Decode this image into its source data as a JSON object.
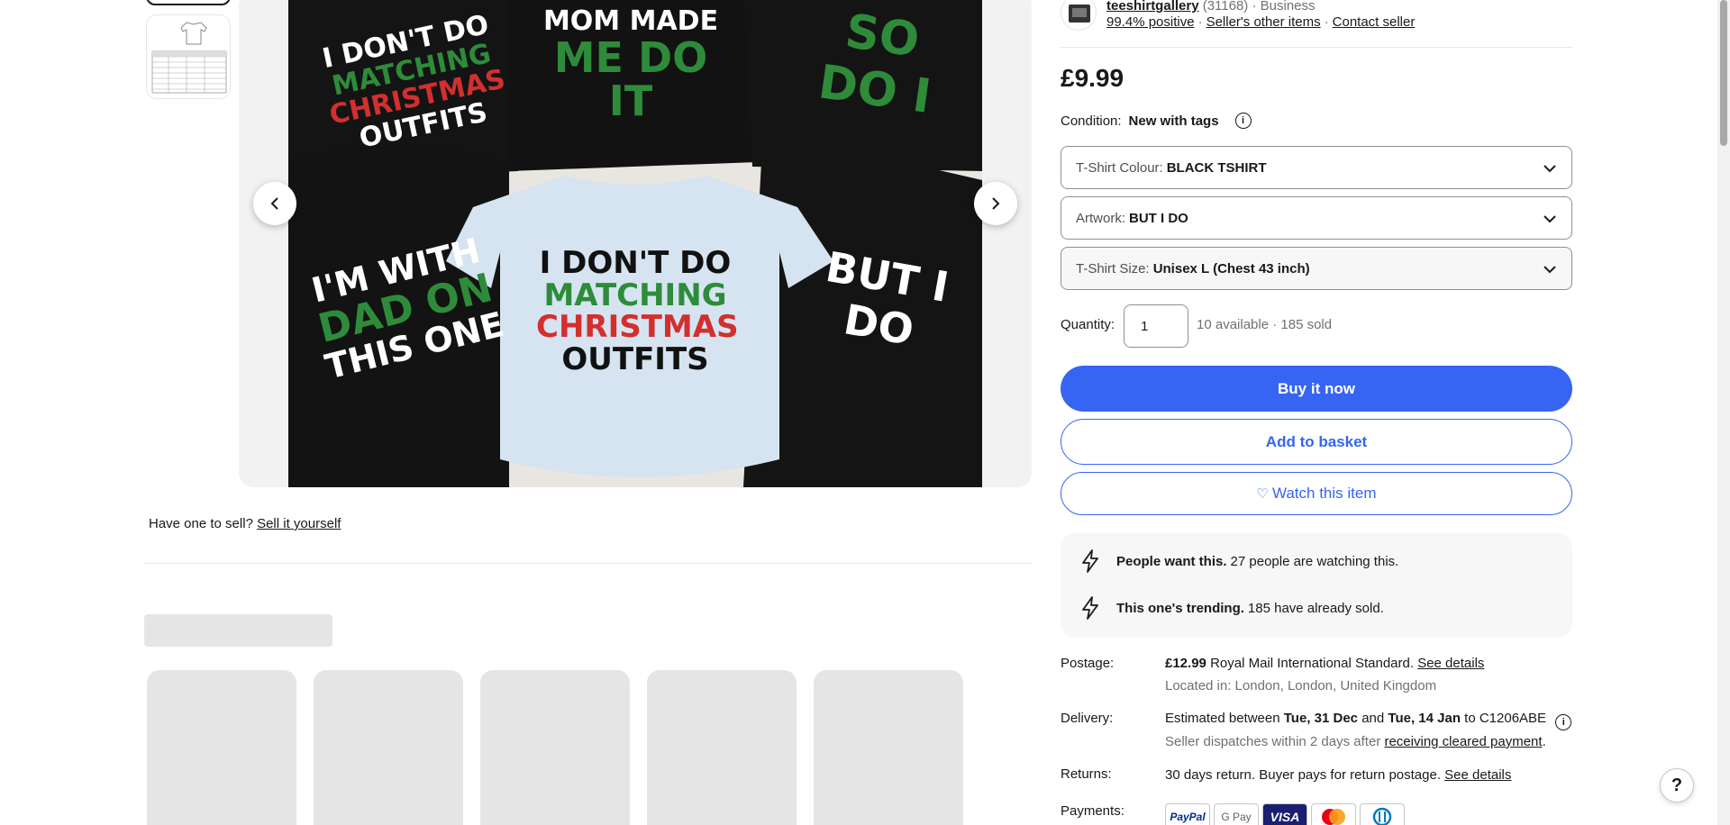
{
  "gallery": {
    "shirts": [
      {
        "line1": "I DON'T DO",
        "line2": "MATCHING",
        "line3": "CHRISTMAS",
        "line4": "OUTFITS"
      },
      {
        "line1": "MOM MADE",
        "line2": "ME DO IT"
      },
      {
        "line1": "SO DO I"
      },
      {
        "line1": "I'M WITH",
        "line2": "DAD ON",
        "line3": "THIS ONE"
      },
      {
        "line1": "I DON'T DO",
        "line2": "MATCHING",
        "line3": "CHRISTMAS",
        "line4": "OUTFITS"
      },
      {
        "line1": "BUT I DO"
      }
    ],
    "prev_icon": "chevron-left-icon",
    "next_icon": "chevron-right-icon"
  },
  "sell": {
    "prompt": "Have one to sell?",
    "link": "Sell it yourself"
  },
  "seller": {
    "name": "teeshirtgallery",
    "feedback_count": "(31168)",
    "type": "· Business",
    "positive": "99.4% positive",
    "other_items": "Seller's other items",
    "contact": "Contact seller"
  },
  "listing": {
    "price": "£9.99",
    "condition_label": "Condition:",
    "condition_value": "New with tags"
  },
  "variations": [
    {
      "label": "T-Shirt Colour:",
      "value": "BLACK TSHIRT"
    },
    {
      "label": "Artwork:",
      "value": "BUT I DO"
    },
    {
      "label": "T-Shirt Size:",
      "value": "Unisex L (Chest 43 inch)"
    }
  ],
  "quantity": {
    "label": "Quantity:",
    "value": "1",
    "availability": "10 available · 185 sold"
  },
  "actions": {
    "buy_now": "Buy it now",
    "add_to_basket": "Add to basket",
    "watch": "Watch this item"
  },
  "signals": [
    {
      "bold": "People want this.",
      "text": "27 people are watching this."
    },
    {
      "bold": "This one's trending.",
      "text": "185 have already sold."
    }
  ],
  "postage": {
    "label": "Postage:",
    "price": "£12.99",
    "service": "Royal Mail International Standard.",
    "link": "See details",
    "location": "Located in: London, London, United Kingdom"
  },
  "delivery": {
    "label": "Delivery:",
    "prefix": "Estimated between",
    "start": "Tue, 31 Dec",
    "and": "and",
    "end": "Tue, 14 Jan",
    "to": "to C1206ABE",
    "dispatch": "Seller dispatches within 2 days after",
    "dispatch_link": "receiving cleared payment",
    "dispatch_end": "."
  },
  "returns": {
    "label": "Returns:",
    "text": "30 days return. Buyer pays for return postage.",
    "link": "See details"
  },
  "payments": {
    "label": "Payments:",
    "methods": [
      "PayPal",
      "G Pay",
      "VISA",
      "Mastercard",
      "Diners Club"
    ]
  },
  "colors": {
    "accent": "#3665f3",
    "shirt_green": "#2e8b3a",
    "shirt_red": "#d32f2f"
  },
  "help_label": "?"
}
